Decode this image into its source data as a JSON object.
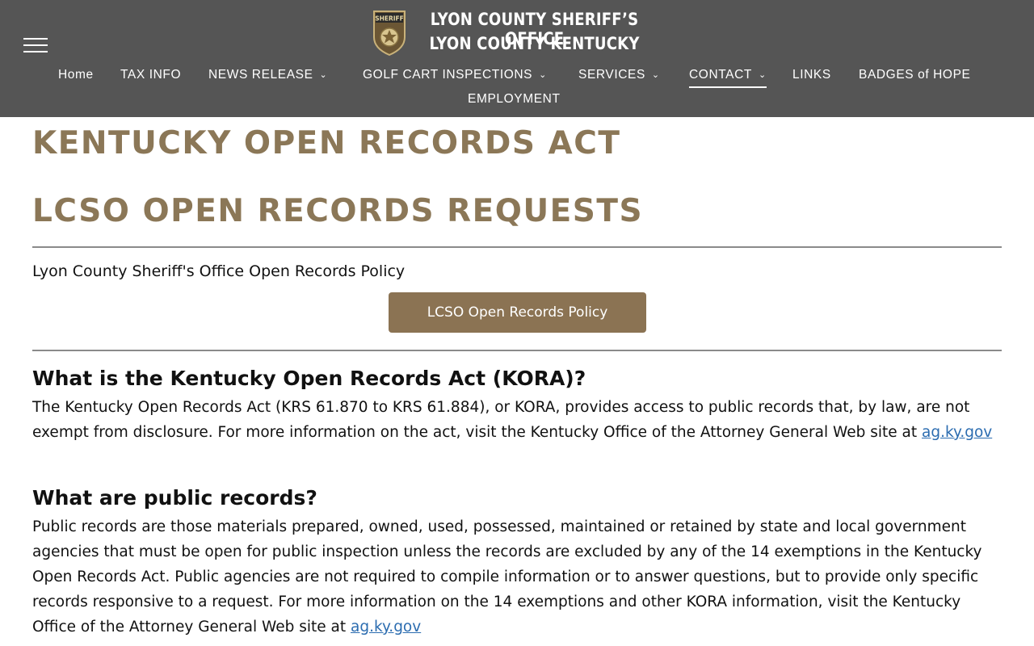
{
  "header": {
    "title_line1": "LYON COUNTY SHERIFF’S OFFICE",
    "title_line2": "LYON COUNTY KENTUCKY",
    "logo_text": "SHERIFF",
    "background_color": "#555555"
  },
  "nav": {
    "row1": [
      {
        "label": "Home",
        "has_dropdown": false
      },
      {
        "label": "TAX INFO",
        "has_dropdown": false
      },
      {
        "label": "NEWS RELEASE",
        "has_dropdown": true
      },
      {
        "label": "GOLF CART INSPECTIONS",
        "has_dropdown": true
      },
      {
        "label": "SERVICES",
        "has_dropdown": true
      },
      {
        "label": "CONTACT",
        "has_dropdown": true,
        "active": true
      },
      {
        "label": "LINKS",
        "has_dropdown": false
      },
      {
        "label": "BADGES of HOPE",
        "has_dropdown": false
      }
    ],
    "row2": [
      {
        "label": "EMPLOYMENT",
        "has_dropdown": false
      }
    ],
    "chevron": "⌄"
  },
  "main": {
    "heading1": "KENTUCKY OPEN RECORDS ACT",
    "heading2": "LCSO OPEN RECORDS REQUESTS",
    "policy_label": "Lyon County Sheriff's Office Open Records Policy",
    "policy_button": "LCSO Open Records Policy",
    "q1": {
      "heading": "What is the Kentucky Open Records Act (KORA)?",
      "text": "The Kentucky Open Records Act (KRS 61.870 to KRS 61.884), or KORA, provides access to public records that, by law, are not exempt from disclosure. For more information on the act, visit the Kentucky Office of the Attorney General Web site at ",
      "link": "ag.ky.gov"
    },
    "q2": {
      "heading": "What are public records?",
      "text": "Public records are those materials prepared, owned, used, possessed, maintained or retained by state and local government agencies that must be open for public inspection unless the records are excluded by any of the 14 exemptions in the Kentucky Open Records Act. Public agencies are not required to compile information or to answer questions, but to provide only specific records responsive to a request. For more information on the 14 exemptions and other KORA information, visit the Kentucky Office of the Attorney General Web site at ",
      "link": "ag.ky.gov"
    }
  },
  "colors": {
    "gold": "#8b7757",
    "button": "#8b7353",
    "link": "#2b6cb0"
  }
}
